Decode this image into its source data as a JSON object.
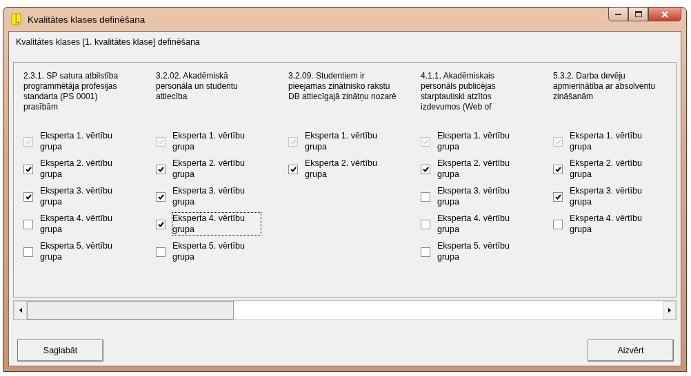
{
  "window": {
    "title": "Kvalitātes klases definēšana"
  },
  "subtitle": "Kvalitātes klases [1. kvalitātes klase] definēšana",
  "columns": [
    {
      "heading": "2.3.1. SP satura atbilstība programmētāja profesijas standarta  (PS 0001) prasībām",
      "options": [
        {
          "label": "Eksperta 1. vērtību grupa",
          "checked": true,
          "disabled": true,
          "focused": false
        },
        {
          "label": "Eksperta 2. vērtību grupa",
          "checked": true,
          "disabled": false,
          "focused": false
        },
        {
          "label": "Eksperta 3. vērtību grupa",
          "checked": true,
          "disabled": false,
          "focused": false
        },
        {
          "label": "Eksperta 4. vērtību grupa",
          "checked": false,
          "disabled": false,
          "focused": false
        },
        {
          "label": "Eksperta 5. vērtību grupa",
          "checked": false,
          "disabled": false,
          "focused": false
        }
      ]
    },
    {
      "heading": "3.2.02. Akadēmiskā personāla un studentu attiecība",
      "options": [
        {
          "label": "Eksperta 1. vērtību grupa",
          "checked": true,
          "disabled": true,
          "focused": false
        },
        {
          "label": "Eksperta 2. vērtību grupa",
          "checked": true,
          "disabled": false,
          "focused": false
        },
        {
          "label": "Eksperta 3. vērtību grupa",
          "checked": true,
          "disabled": false,
          "focused": false
        },
        {
          "label": "Eksperta 4. vērtību grupa",
          "checked": true,
          "disabled": false,
          "focused": true
        },
        {
          "label": "Eksperta 5. vērtību grupa",
          "checked": false,
          "disabled": false,
          "focused": false
        }
      ]
    },
    {
      "heading": "3.2.09. Studentiem ir pieejamas zinātnisko rakstu DB attiecīgajā zinātņu nozarē",
      "options": [
        {
          "label": "Eksperta 1. vērtību grupa",
          "checked": true,
          "disabled": true,
          "focused": false
        },
        {
          "label": "Eksperta 2. vērtību grupa",
          "checked": true,
          "disabled": false,
          "focused": false
        }
      ]
    },
    {
      "heading": "4.1.1. Akadēmiskais personāls publicējas starptautiski atzītos izdevumos (Web of",
      "options": [
        {
          "label": "Eksperta 1. vērtību grupa",
          "checked": true,
          "disabled": true,
          "focused": false
        },
        {
          "label": "Eksperta 2. vērtību grupa",
          "checked": true,
          "disabled": false,
          "focused": false
        },
        {
          "label": "Eksperta 3. vērtību grupa",
          "checked": false,
          "disabled": false,
          "focused": false
        },
        {
          "label": "Eksperta 4. vērtību grupa",
          "checked": false,
          "disabled": false,
          "focused": false
        },
        {
          "label": "Eksperta 5. vērtību grupa",
          "checked": false,
          "disabled": false,
          "focused": false
        }
      ]
    },
    {
      "heading": "5.3.2. Darba devēju apmierinātība ar absolventu zināšanām",
      "options": [
        {
          "label": "Eksperta 1. vērtību grupa",
          "checked": true,
          "disabled": true,
          "focused": false
        },
        {
          "label": "Eksperta 2. vērtību grupa",
          "checked": true,
          "disabled": false,
          "focused": false
        },
        {
          "label": "Eksperta 3. vērtību grupa",
          "checked": true,
          "disabled": false,
          "focused": false
        },
        {
          "label": "Eksperta 4. vērtību grupa",
          "checked": false,
          "disabled": false,
          "focused": false
        }
      ]
    }
  ],
  "buttons": [
    {
      "label": "Saglabāt"
    },
    {
      "label": "Aizvērt"
    }
  ]
}
